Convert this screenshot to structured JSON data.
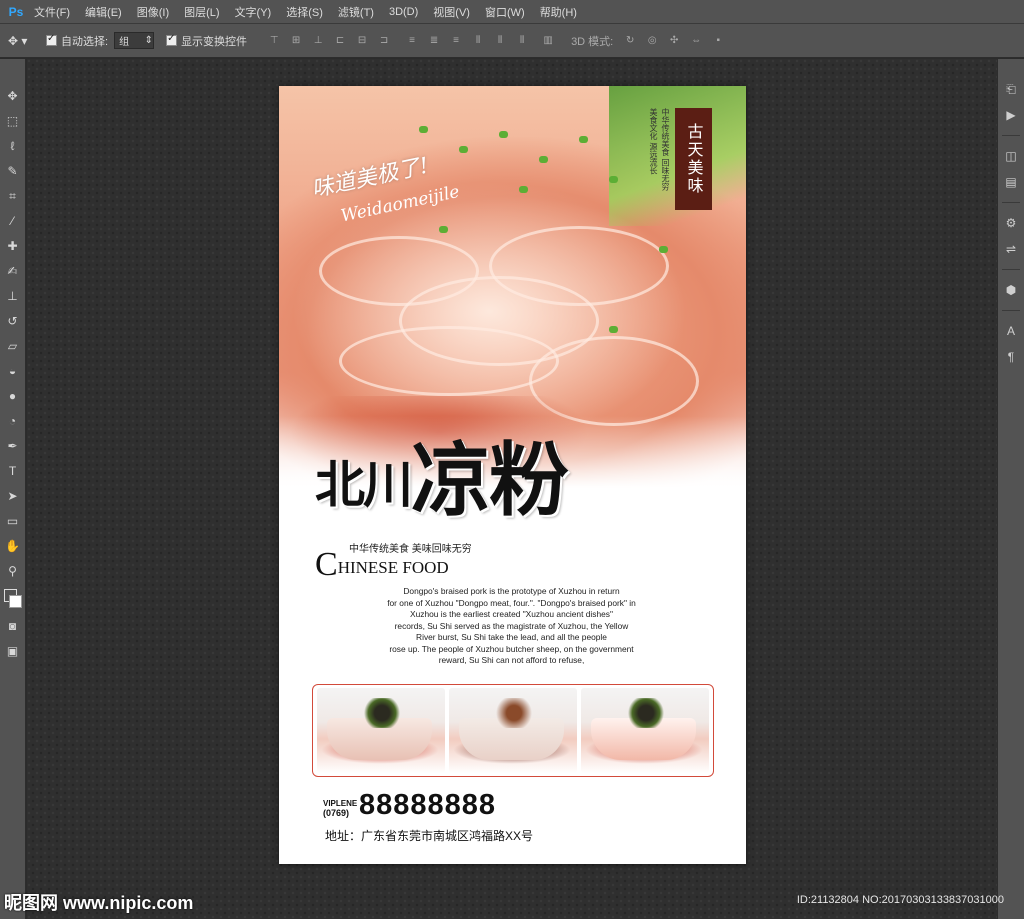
{
  "app": {
    "logo": "Ps",
    "accent": "#31a8ff"
  },
  "menu": [
    "文件(F)",
    "编辑(E)",
    "图像(I)",
    "图层(L)",
    "文字(Y)",
    "选择(S)",
    "滤镜(T)",
    "3D(D)",
    "视图(V)",
    "窗口(W)",
    "帮助(H)"
  ],
  "options": {
    "auto_select_label": "自动选择:",
    "auto_select_value": "组",
    "show_transform_label": "显示变换控件",
    "mode_3d_label": "3D 模式:"
  },
  "left_tools": [
    "move-tool",
    "marquee-tool",
    "lasso-tool",
    "quick-select-tool",
    "crop-tool",
    "eyedropper-tool",
    "healing-tool",
    "brush-tool",
    "stamp-tool",
    "history-brush-tool",
    "eraser-tool",
    "paint-bucket-tool",
    "blur-tool",
    "dodge-tool",
    "pen-tool",
    "type-tool",
    "path-select-tool",
    "shape-tool",
    "hand-tool",
    "zoom-tool"
  ],
  "right_panel_icons": [
    "history-icon",
    "actions-icon",
    "layers-icon",
    "adjustments-icon",
    "properties-icon",
    "3d-icon",
    "character-icon",
    "paragraph-icon"
  ],
  "poster": {
    "script_line1": "味道美极了!",
    "script_line2": "Weidaomeijile",
    "seal_text": "古天美味",
    "vertical_text1": "中华传统美食 回味无穷",
    "vertical_text2": "美食文化 源远流长",
    "title_chars": [
      "北",
      "川",
      "凉",
      "粉"
    ],
    "cn_tagline": "中华传统美食  美味回味无穷",
    "en_title_initial": "C",
    "en_title_rest": "HINESE FOOD",
    "description": [
      "Dongpo's braised pork is the prototype of Xuzhou in return",
      "for one of Xuzhou \"Dongpo meat, four.\". \"Dongpo's braised pork\" in",
      "Xuzhou is the earliest created \"Xuzhou ancient dishes\"",
      "records, Su Shi served as the magistrate of Xuzhou, the Yellow",
      "River burst, Su Shi take the lead, and all the people",
      "rose up. The people of Xuzhou butcher sheep, on the government",
      "reward, Su Shi can not afford to refuse,"
    ],
    "contact_label1": "VIPLENE",
    "contact_label2": "(0769)",
    "phone": "88888888",
    "address": "地址：广东省东莞市南城区鸿福路XX号"
  },
  "watermark": {
    "left": "昵图网 www.nipic.com",
    "right": "ID:21132804 NO:20170303133837031000"
  }
}
